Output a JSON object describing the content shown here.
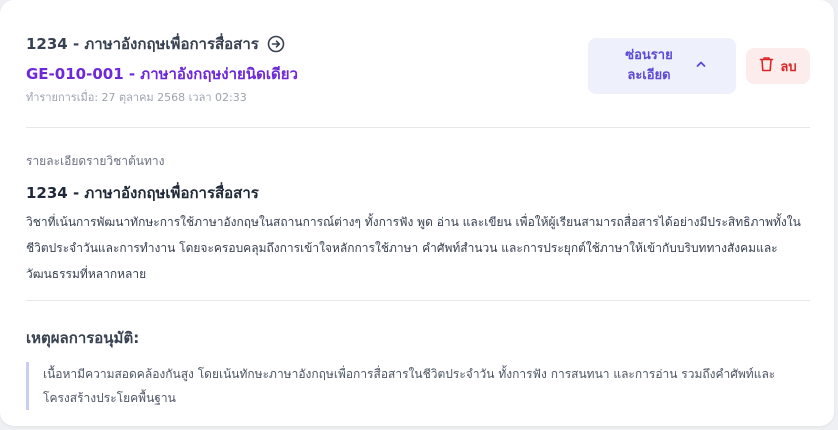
{
  "course": {
    "title": "1234 - ภาษาอังกฤษเพื่อการสื่อสาร",
    "equivalent": "GE-010-001 - ภาษาอังกฤษง่ายนิดเดียว",
    "timestamp": "ทำรายการเมื่อ: 27 ตุลาคม 2568 เวลา 02:33"
  },
  "actions": {
    "toggle_label": "ซ่อนรายละเอียด",
    "delete_label": "ลบ"
  },
  "detail": {
    "section_label": "รายละเอียดรายวิชาต้นทาง",
    "title": "1234 - ภาษาอังกฤษเพื่อการสื่อสาร",
    "description": "วิชาที่เน้นการพัฒนาทักษะการใช้ภาษาอังกฤษในสถานการณ์ต่างๆ ทั้งการฟัง พูด อ่าน และเขียน เพื่อให้ผู้เรียนสามารถสื่อสารได้อย่างมีประสิทธิภาพทั้งในชีวิตประจำวันและการทำงาน โดยจะครอบคลุมถึงการเข้าใจหลักการใช้ภาษา คำศัพท์สำนวน และการประยุกต์ใช้ภาษาให้เข้ากับบริบททางสังคมและวัฒนธรรมที่หลากหลาย"
  },
  "reason": {
    "heading": "เหตุผลการอนุมัติ:",
    "text": "เนื้อหามีความสอดคล้องกันสูง โดยเน้นทักษะภาษาอังกฤษเพื่อการสื่อสารในชีวิตประจำวัน ทั้งการฟัง การสนทนา และการอ่าน รวมถึงคำศัพท์และโครงสร้างประโยคพื้นฐาน"
  },
  "icons": {
    "arrow": "arrow-right-circle-icon",
    "chevron": "chevron-up-icon",
    "trash": "trash-icon"
  },
  "colors": {
    "accent": "#6d28d9",
    "danger": "#dc2626",
    "toggle_bg": "#eef0fc",
    "delete_bg": "#fdecec"
  }
}
